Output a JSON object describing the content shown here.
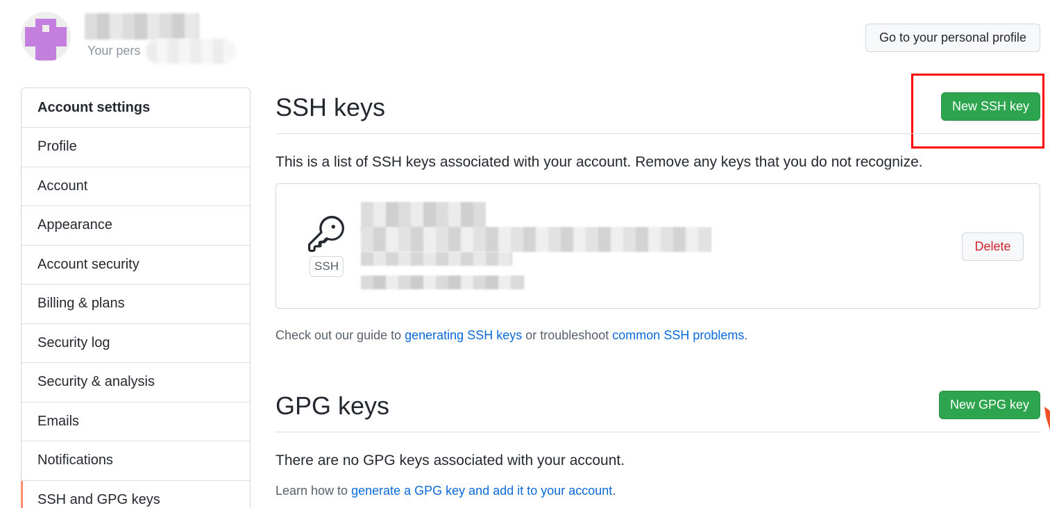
{
  "header": {
    "user_subtitle": "Your pers",
    "profile_button": "Go to your personal profile"
  },
  "sidebar": {
    "heading": "Account settings",
    "items": [
      {
        "label": "Profile"
      },
      {
        "label": "Account"
      },
      {
        "label": "Appearance"
      },
      {
        "label": "Account security"
      },
      {
        "label": "Billing & plans"
      },
      {
        "label": "Security log"
      },
      {
        "label": "Security & analysis"
      },
      {
        "label": "Emails"
      },
      {
        "label": "Notifications"
      },
      {
        "label": "SSH and GPG keys"
      }
    ],
    "active_item": "SSH and GPG keys"
  },
  "ssh": {
    "title": "SSH keys",
    "new_button": "New SSH key",
    "intro": "This is a list of SSH keys associated with your account. Remove any keys that you do not recognize.",
    "key": {
      "type_label": "SSH",
      "delete_button": "Delete"
    },
    "help_prefix": "Check out our guide to ",
    "help_link1": "generating SSH keys",
    "help_middle": " or troubleshoot ",
    "help_link2": "common SSH problems",
    "help_suffix": "."
  },
  "gpg": {
    "title": "GPG keys",
    "new_button": "New GPG key",
    "empty_message": "There are no GPG keys associated with your account.",
    "help_prefix": "Learn how to ",
    "help_link": "generate a GPG key and add it to your account",
    "help_suffix": "."
  },
  "colors": {
    "primary_button": "#2da44e",
    "danger_text": "#cf222e",
    "link": "#0969da",
    "annotation_box": "#ff0000",
    "active_indicator": "#fd8c73",
    "avatar": "#c47ede"
  },
  "icons": {
    "key": "key-icon",
    "avatar": "identicon-avatar"
  }
}
